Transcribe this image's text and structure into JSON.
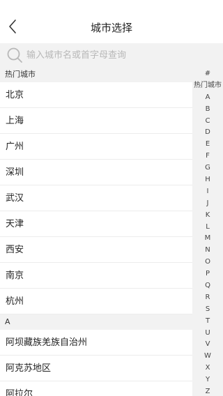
{
  "header": {
    "title": "城市选择",
    "back_icon": "chevron-left-icon"
  },
  "search": {
    "placeholder": "输入城市名或首字母查询",
    "icon": "search-icon"
  },
  "sections": [
    {
      "title": "热门城市",
      "cities": [
        "北京",
        "上海",
        "广州",
        "深圳",
        "武汉",
        "天津",
        "西安",
        "南京",
        "杭州"
      ]
    },
    {
      "title": "A",
      "cities": [
        "阿坝藏族羌族自治州",
        "阿克苏地区",
        "阿拉尔"
      ]
    }
  ],
  "index": [
    "#",
    "热门城市",
    "A",
    "B",
    "C",
    "D",
    "E",
    "F",
    "G",
    "H",
    "I",
    "J",
    "K",
    "L",
    "M",
    "N",
    "O",
    "P",
    "Q",
    "R",
    "S",
    "T",
    "U",
    "V",
    "W",
    "X",
    "Y",
    "Z"
  ],
  "colors": {
    "background": "#ffffff",
    "section_bg": "#f2f2f2",
    "divider": "#ececec",
    "placeholder": "#b8b8b8",
    "text": "#222222"
  }
}
